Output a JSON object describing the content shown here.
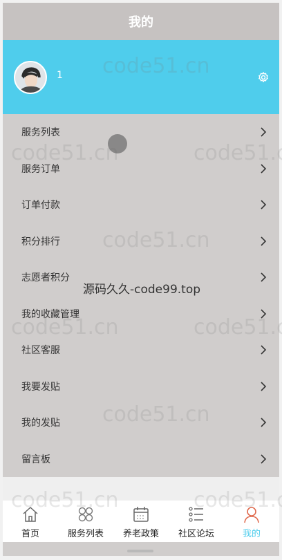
{
  "header": {
    "title": "我的"
  },
  "profile": {
    "username": "1"
  },
  "menu": {
    "items": [
      {
        "label": "服务列表"
      },
      {
        "label": "服务订单"
      },
      {
        "label": "订单付款"
      },
      {
        "label": "积分排行"
      },
      {
        "label": "志愿者积分"
      },
      {
        "label": "我的收藏管理"
      },
      {
        "label": "社区客服"
      },
      {
        "label": "我要发贴"
      },
      {
        "label": "我的发贴"
      },
      {
        "label": "留言板"
      }
    ]
  },
  "tabbar": {
    "items": [
      {
        "label": "首页",
        "icon": "home-icon"
      },
      {
        "label": "服务列表",
        "icon": "grid-icon"
      },
      {
        "label": "养老政策",
        "icon": "calendar-icon"
      },
      {
        "label": "社区论坛",
        "icon": "list-icon"
      },
      {
        "label": "我的",
        "icon": "user-icon",
        "active": true
      }
    ]
  },
  "overlay": {
    "watermark": "code51.cn",
    "center_text": "源码久久-code99.top"
  },
  "colors": {
    "accent": "#4fcdec",
    "header_bg": "#c6c2c1",
    "menu_bg": "#d0cdcc"
  }
}
